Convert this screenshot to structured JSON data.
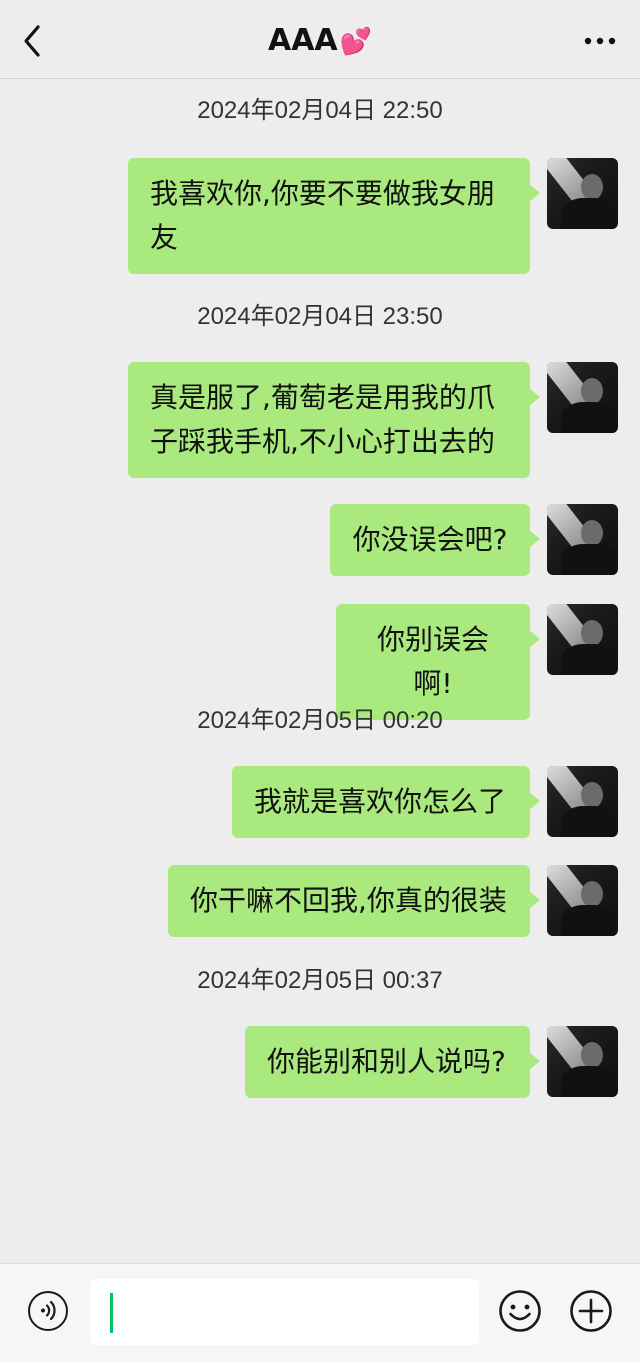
{
  "header": {
    "title": "AAA",
    "title_emoji": "💕",
    "back_icon": "chevron-left-icon",
    "more_icon": "more-horizontal-icon"
  },
  "messages": [
    {
      "timestamp": "2024年02月04日 22:50",
      "text": "我喜欢你,你要不要做我女朋\n友"
    },
    {
      "timestamp": "2024年02月04日 23:50",
      "text": "真是服了,葡萄老是用我的爪\n子踩我手机,不小心打出去的"
    },
    {
      "text": "你没误会吧?"
    },
    {
      "text": "你别误会啊!"
    },
    {
      "timestamp": "2024年02月05日 00:20",
      "text": "我就是喜欢你怎么了"
    },
    {
      "text": "你干嘛不回我,你真的很装"
    },
    {
      "timestamp": "2024年02月05日 00:37",
      "text": "你能别和别人说吗?"
    }
  ],
  "composer": {
    "input_value": "",
    "voice_icon": "voice-icon",
    "emoji_icon": "emoji-icon",
    "plus_icon": "plus-icon"
  },
  "colors": {
    "background": "#ededed",
    "bubble": "#a9e97e",
    "caret": "#07c160"
  }
}
